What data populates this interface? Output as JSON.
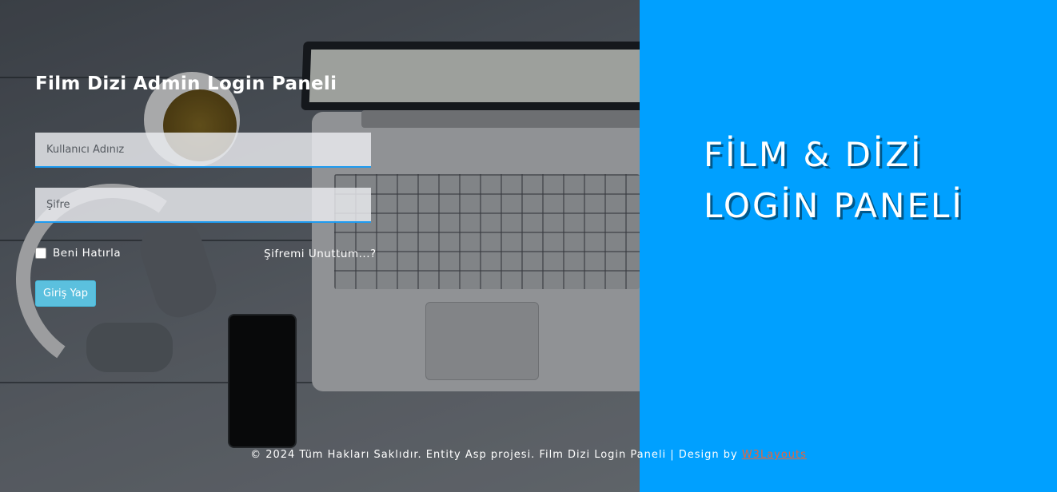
{
  "form": {
    "title": "Film Dizi Admin Login Paneli",
    "username_placeholder": "Kullanıcı Adınız",
    "password_placeholder": "Şifre",
    "remember_label": "Beni Hatırla",
    "remember_checked": false,
    "forgot_label": "Şifremi Unuttum...?",
    "submit_label": "Giriş Yap"
  },
  "brand": {
    "line1": "FİLM & DİZİ",
    "line2": "LOGİN PANELİ"
  },
  "footer": {
    "text": "© 2024 Tüm Hakları Saklıdır. Entity Asp projesi. Film Dizi Login Paneli | Design by ",
    "credit": "W3Layouts"
  },
  "colors": {
    "right_panel": "#00a0ff",
    "button": "#5bc0de",
    "input_underline": "#1e9bf0",
    "credit_link": "#e9643a"
  },
  "icons": {
    "remember_checkbox": "checkbox-unchecked-icon"
  }
}
